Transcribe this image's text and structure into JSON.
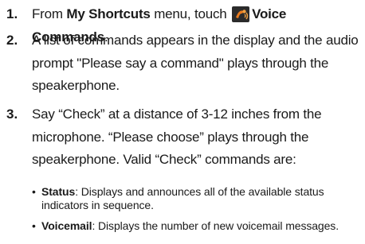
{
  "steps": [
    {
      "num": "1.",
      "pre": "From ",
      "menu": "My Shortcuts",
      "mid": " menu, touch ",
      "icon": "voice-commands-icon",
      "action": "Voice Commands",
      "post": "."
    },
    {
      "num": "2.",
      "text": "A list of commands appears in the display and the audio prompt \"Please say a command\" plays through the speakerphone."
    },
    {
      "num": "3.",
      "text": "Say “Check” at a distance of 3-12 inches from the microphone. “Please choose” plays through the speakerphone. Valid “Check” commands are:"
    }
  ],
  "bullets": [
    {
      "term": "Status",
      "desc": ": Displays and announces all of the available status indicators in sequence."
    },
    {
      "term": "Voicemail",
      "desc": ": Displays the number of new voicemail messages."
    }
  ],
  "colors": {
    "icon_orange": "#e87a1e",
    "icon_dark": "#3a3a3a",
    "text": "#1a1a1a"
  }
}
